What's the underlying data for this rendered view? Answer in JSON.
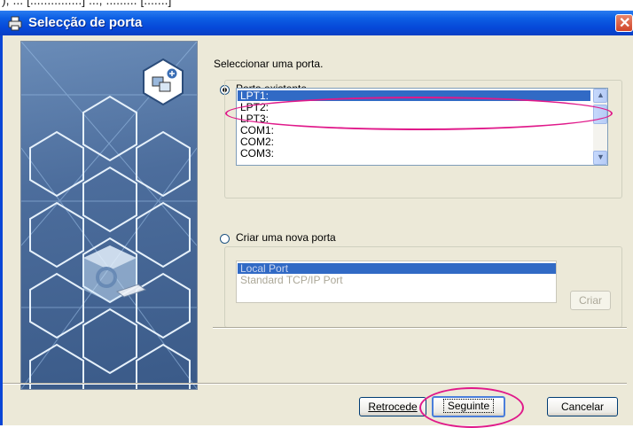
{
  "top_text": "), ... [...............] ..., ......... [.......]",
  "window": {
    "title": "Selecção de porta",
    "close_glyph": "✕"
  },
  "instruction": "Seleccionar uma porta.",
  "existing_port": {
    "label": "Porta existente",
    "checked": true,
    "ports": [
      "LPT1:",
      "LPT2:",
      "LPT3:",
      "COM1:",
      "COM2:",
      "COM3:"
    ],
    "selected": "LPT1:"
  },
  "new_port": {
    "label": "Criar uma nova porta",
    "checked": false,
    "port_types": [
      "Local Port",
      "Standard TCP/IP Port"
    ],
    "selected": "Local Port",
    "create_button": "Criar"
  },
  "footer": {
    "back_button": "Retrocede",
    "next_button": "Seguinte",
    "cancel_button": "Cancelar"
  },
  "colors": {
    "titlebar": "#0a46d6",
    "selection": "#316ac5",
    "highlight_ellipse": "#e0198a",
    "dialog_bg": "#ece9d8"
  },
  "icons": {
    "title": "printer-icon",
    "scroll_up": "arrow-up-icon",
    "scroll_down": "arrow-down-icon"
  }
}
